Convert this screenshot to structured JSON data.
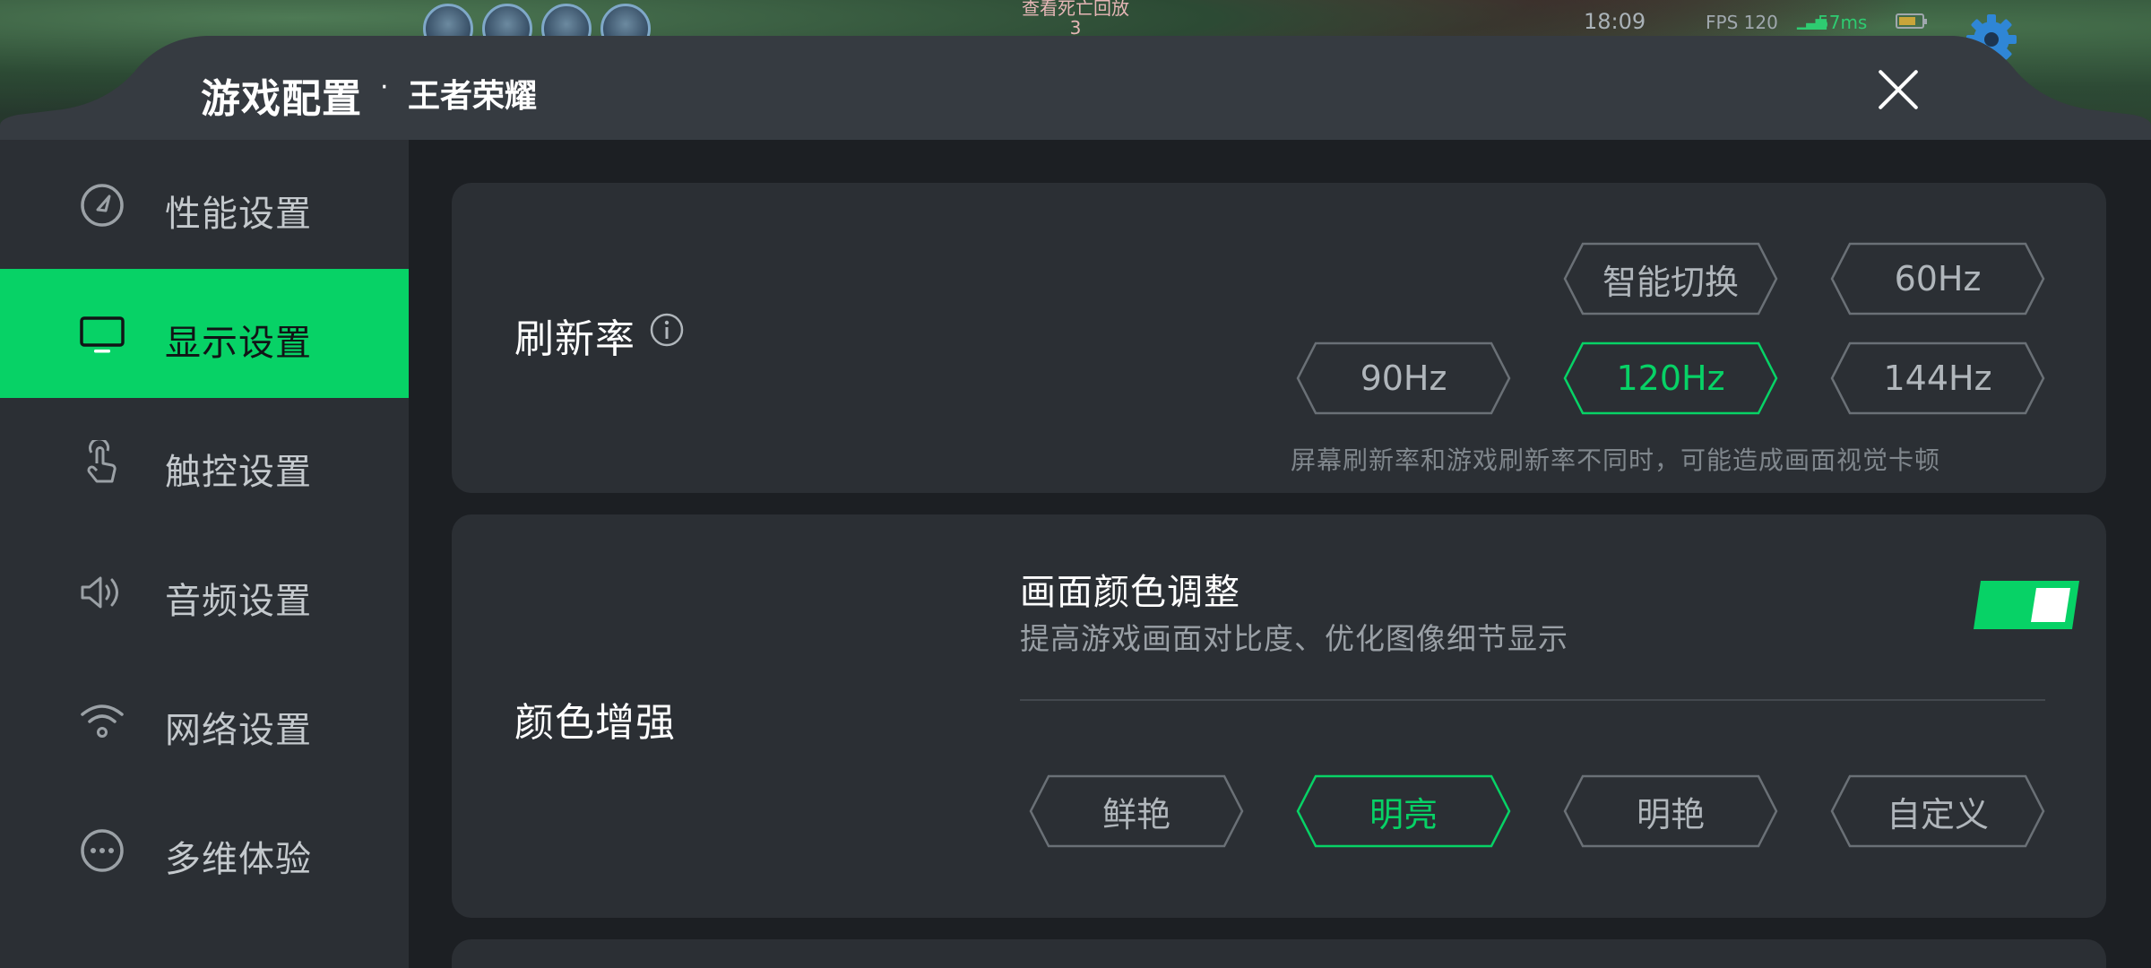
{
  "game_overlay": {
    "replay_label": "查看死亡回放",
    "replay_count": "3",
    "time": "18:09",
    "fps": "FPS 120",
    "ping": "57ms",
    "battery_level": 0.6,
    "gear_icon": "gear-icon"
  },
  "header": {
    "title": "游戏配置",
    "separator": "·",
    "subtitle": "王者荣耀",
    "close_icon": "close-icon"
  },
  "sidebar": {
    "items": [
      {
        "label": "性能设置",
        "icon": "speedometer-icon",
        "active": false
      },
      {
        "label": "显示设置",
        "icon": "monitor-icon",
        "active": true
      },
      {
        "label": "触控设置",
        "icon": "touch-hand-icon",
        "active": false
      },
      {
        "label": "音频设置",
        "icon": "speaker-icon",
        "active": false
      },
      {
        "label": "网络设置",
        "icon": "wifi-icon",
        "active": false
      },
      {
        "label": "多维体验",
        "icon": "more-dots-icon",
        "active": false
      }
    ]
  },
  "refresh_rate": {
    "title": "刷新率",
    "info_icon": "info-icon",
    "options": [
      "智能切换",
      "60Hz",
      "90Hz",
      "120Hz",
      "144Hz"
    ],
    "selected": "120Hz",
    "hint": "屏幕刷新率和游戏刷新率不同时，可能造成画面视觉卡顿"
  },
  "color_enhance": {
    "title": "颜色增强",
    "adjust_title": "画面颜色调整",
    "adjust_desc": "提高游戏画面对比度、优化图像细节显示",
    "toggle_on": true,
    "modes": [
      "鲜艳",
      "明亮",
      "明艳",
      "自定义"
    ],
    "selected_mode": "明亮"
  },
  "colors": {
    "accent": "#07d266",
    "panel_bg": "#2b2f34",
    "content_bg": "#1c1f23",
    "text_muted": "#b0b6bb"
  }
}
